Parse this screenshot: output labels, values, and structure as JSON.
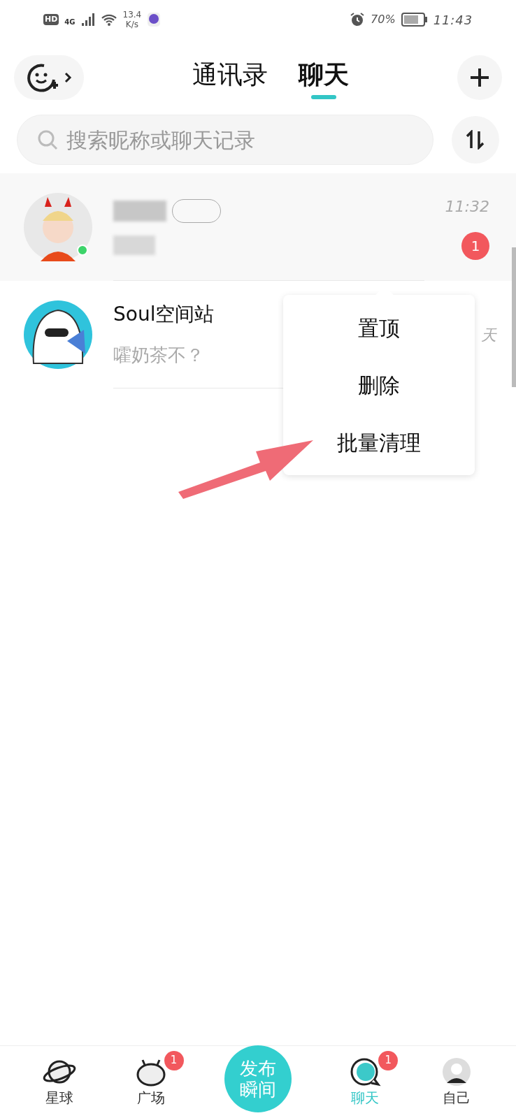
{
  "status_bar": {
    "hd": "HD",
    "network": "4G",
    "speed": "13.4",
    "speed_unit": "K/s",
    "battery": "70%",
    "time": "11:43"
  },
  "header": {
    "tabs": [
      {
        "label": "通讯录",
        "selected": false
      },
      {
        "label": "聊天",
        "selected": true
      }
    ]
  },
  "search": {
    "placeholder": "搜索昵称或聊天记录"
  },
  "chats": [
    {
      "kind": "blurred",
      "time": "11:32",
      "unread": "1",
      "online": true,
      "highlighted": true
    },
    {
      "kind": "normal",
      "name": "Soul空间站",
      "message": "嚯奶茶不？",
      "time": "天",
      "online": false,
      "highlighted": false
    }
  ],
  "context_menu": {
    "items": [
      "置顶",
      "删除",
      "批量清理"
    ]
  },
  "bottom_nav": {
    "publish": [
      "发布",
      "瞬间"
    ],
    "items": [
      {
        "label": "星球",
        "selected": false
      },
      {
        "label": "广场",
        "selected": false,
        "badge": "1"
      },
      {
        "label": "聊天",
        "selected": true,
        "badge": "1"
      },
      {
        "label": "自己",
        "selected": false
      }
    ]
  }
}
